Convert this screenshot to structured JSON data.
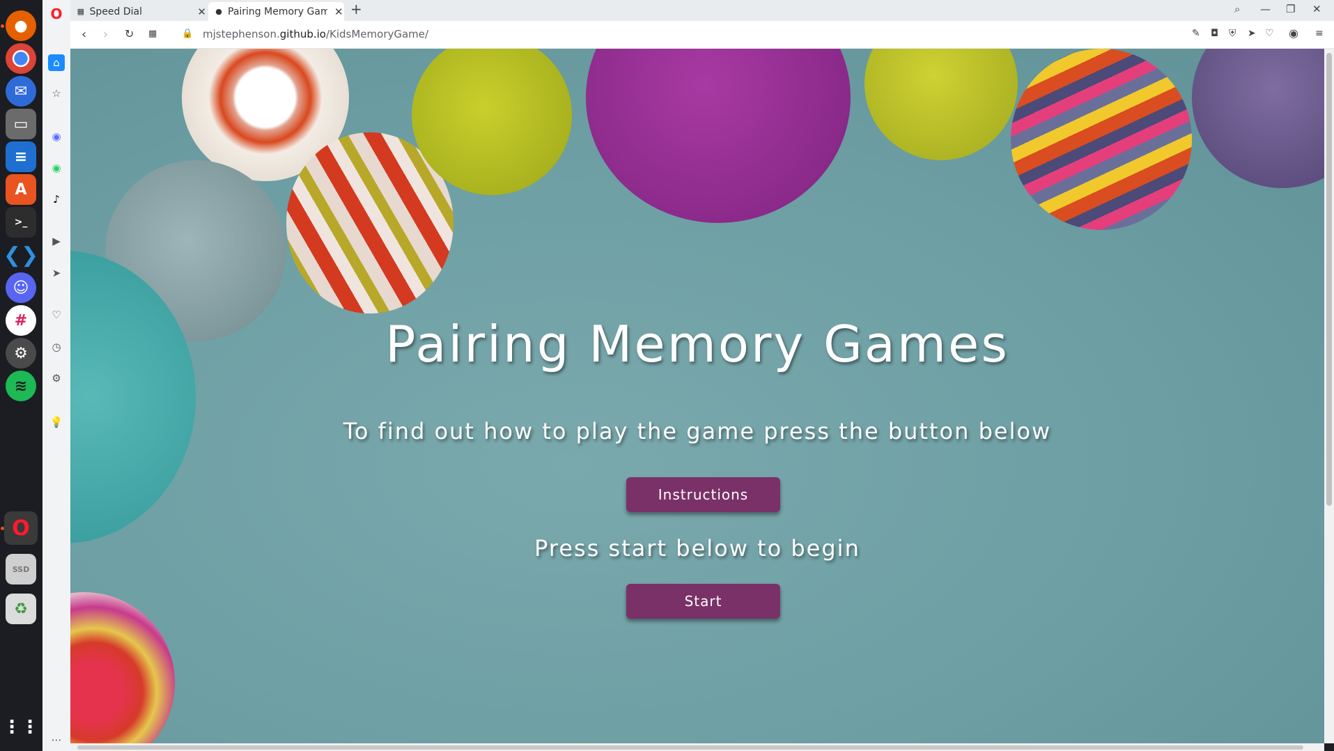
{
  "dock": {
    "apps": [
      "firefox-icon",
      "chrome-icon",
      "thunderbird-icon",
      "files-icon",
      "writer-icon",
      "software-icon",
      "terminal-icon",
      "vscode-icon",
      "discord-icon",
      "slack-icon",
      "settings-icon",
      "spotify-icon",
      "opera-icon",
      "ssd-icon",
      "trash-icon"
    ],
    "ssd_label": "SSD"
  },
  "browser": {
    "tabs": [
      {
        "label": "Speed Dial",
        "icon": "speed-dial-icon"
      },
      {
        "label": "Pairing Memory Gam",
        "icon": "game-favicon"
      }
    ],
    "url_prefix": "mjstephenson.",
    "url_host": "github.io",
    "url_path": "/KidsMemoryGame/"
  },
  "page": {
    "title": "Pairing Memory Games",
    "subtitle": "To find out how to play the game press the button below",
    "instructions_button": "Instructions",
    "start_prompt": "Press start below to begin",
    "start_button": "Start"
  },
  "colors": {
    "button_bg": "#7a3168",
    "page_bg": "#6c9ea3"
  }
}
